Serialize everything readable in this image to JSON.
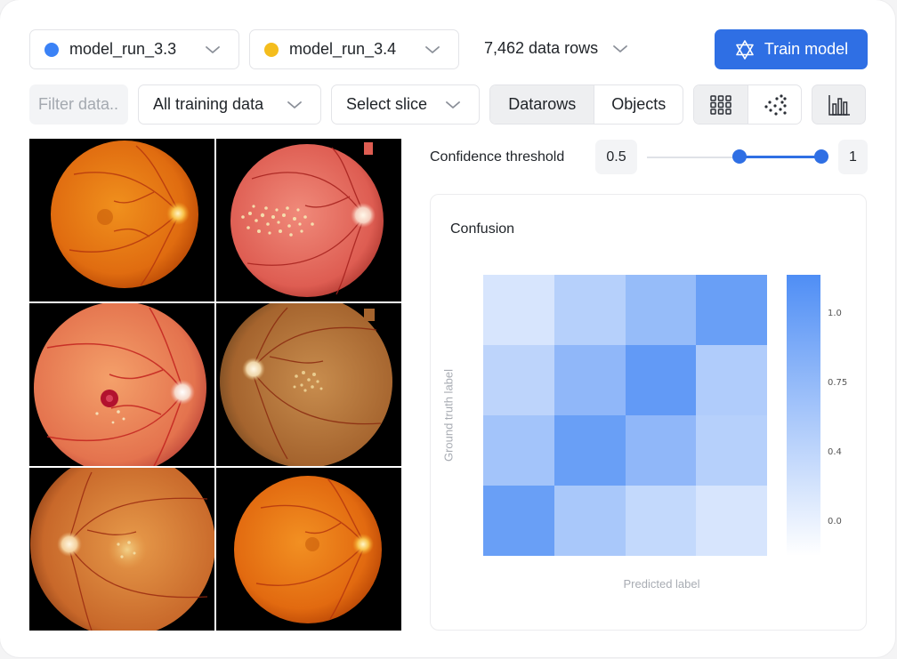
{
  "toolbar": {
    "run_a": {
      "label": "model_run_3.3",
      "color": "#3b82f6"
    },
    "run_b": {
      "label": "model_run_3.4",
      "color": "#f4bd1d"
    },
    "rows_label": "7,462 data rows",
    "train_label": "Train model"
  },
  "filters": {
    "search_placeholder": "Filter data...",
    "data_scope": "All training data",
    "slice": "Select slice",
    "tabs": [
      "Datarows",
      "Objects"
    ],
    "active_tab": "Datarows",
    "view_icons": [
      "grid-view-icon",
      "scatter-view-icon"
    ],
    "chart_icon": "bar-chart-icon"
  },
  "gallery": {
    "images": [
      {
        "icon": "retina-image",
        "variant": "healthy"
      },
      {
        "icon": "retina-image",
        "variant": "exudates"
      },
      {
        "icon": "retina-image",
        "variant": "hemorrhage"
      },
      {
        "icon": "retina-image",
        "variant": "drusen"
      },
      {
        "icon": "retina-image",
        "variant": "pale-lesion"
      },
      {
        "icon": "retina-image",
        "variant": "healthy"
      }
    ]
  },
  "confidence": {
    "label": "Confidence threshold",
    "min_label": "0.5",
    "max_label": "1",
    "low": 0.5,
    "high": 1.0
  },
  "chart_data": {
    "type": "heatmap",
    "title": "Confusion",
    "xlabel": "Predicted label",
    "ylabel": "Ground truth label",
    "matrix": [
      [
        0.15,
        0.4,
        0.65,
        1.0
      ],
      [
        0.35,
        0.7,
        1.05,
        0.45
      ],
      [
        0.55,
        1.0,
        0.7,
        0.4
      ],
      [
        1.0,
        0.5,
        0.3,
        0.15
      ]
    ],
    "colorbar": {
      "ticks": [
        "1.0",
        "0.75",
        "0.4",
        "0.0"
      ],
      "range": [
        0.0,
        1.2
      ]
    },
    "color_high": "#4f8ef5",
    "color_low": "#ffffff"
  }
}
